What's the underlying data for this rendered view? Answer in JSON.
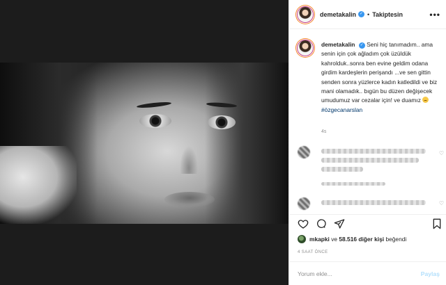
{
  "post": {
    "username": "demetakalin",
    "follow_status": "Takiptesin",
    "more_label": "•••",
    "caption_username": "demetakalin",
    "caption_text": "Seni hiç tanımadım.. ama senin için çok ağladım çok üzüldük kahrolduk..sonra ben evine geldim odana girdim kardeşlerin perişandı ...ve sen gittin senden sonra yüzlerce kadın katledildi ve biz mani olamadık.. bıgün bu düzen değişecek umudumuz var cezalar için! ve duamız",
    "hashtag": "#özgecanarslan",
    "caption_time": "4s"
  },
  "actions": {
    "like_icon": "heart-icon",
    "comment_icon": "comment-icon",
    "share_icon": "share-icon",
    "save_icon": "bookmark-icon"
  },
  "likes": {
    "first_liker": "mkapki",
    "joiner": "ve",
    "others": "58.516 diğer kişi",
    "suffix": "beğendi"
  },
  "posted_ago": "4 SAAT ÖNCE",
  "comment_box": {
    "placeholder": "Yorum ekle...",
    "post_label": "Paylaş"
  },
  "colors": {
    "verified": "#3897f0",
    "hashtag": "#00376b",
    "post_button": "#b2dffc",
    "muted": "#8e8e8e"
  }
}
